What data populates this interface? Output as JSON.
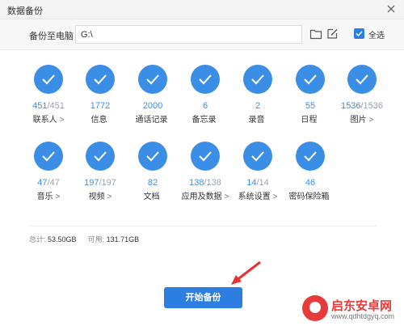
{
  "window": {
    "title": "数据备份"
  },
  "pathbar": {
    "label": "备份至电脑",
    "path_value": "G:\\",
    "select_all_label": "全选",
    "select_all_checked": true
  },
  "items": [
    {
      "count": "451",
      "total": "/451",
      "name": "联系人",
      "arrow": ">"
    },
    {
      "count": "1772",
      "total": "",
      "name": "信息",
      "arrow": ""
    },
    {
      "count": "2000",
      "total": "",
      "name": "通话记录",
      "arrow": ""
    },
    {
      "count": "6",
      "total": "",
      "name": "备忘录",
      "arrow": ""
    },
    {
      "count": "2",
      "total": "",
      "name": "录音",
      "arrow": ""
    },
    {
      "count": "55",
      "total": "",
      "name": "日程",
      "arrow": ""
    },
    {
      "count": "1536",
      "total": "/1536",
      "name": "图片",
      "arrow": ">"
    },
    {
      "count": "47",
      "total": "/47",
      "name": "音乐",
      "arrow": ">"
    },
    {
      "count": "197",
      "total": "/197",
      "name": "视频",
      "arrow": ">"
    },
    {
      "count": "82",
      "total": "",
      "name": "文档",
      "arrow": ""
    },
    {
      "count": "138",
      "total": "/138",
      "name": "应用及数据",
      "arrow": ">"
    },
    {
      "count": "14",
      "total": "/14",
      "name": "系统设置",
      "arrow": ">"
    },
    {
      "count": "46",
      "total": "",
      "name": "密码保险箱",
      "arrow": ""
    }
  ],
  "summary": {
    "total_label": "总计:",
    "total_value": "53.50GB",
    "available_label": "可用:",
    "available_value": "131.71GB"
  },
  "start_button_label": "开始备份",
  "watermark": {
    "brand": "启东安卓网",
    "url": "www.qdhtdgyq.com"
  },
  "colors": {
    "accent": "#2c7ee0",
    "item_circle": "#3a8ee6",
    "total_gray": "#9aa3ad",
    "watermark_red": "#e73b3b"
  },
  "icons": {
    "close": "close-icon",
    "folder": "folder-icon",
    "edit": "edit-icon",
    "check": "check-icon"
  }
}
